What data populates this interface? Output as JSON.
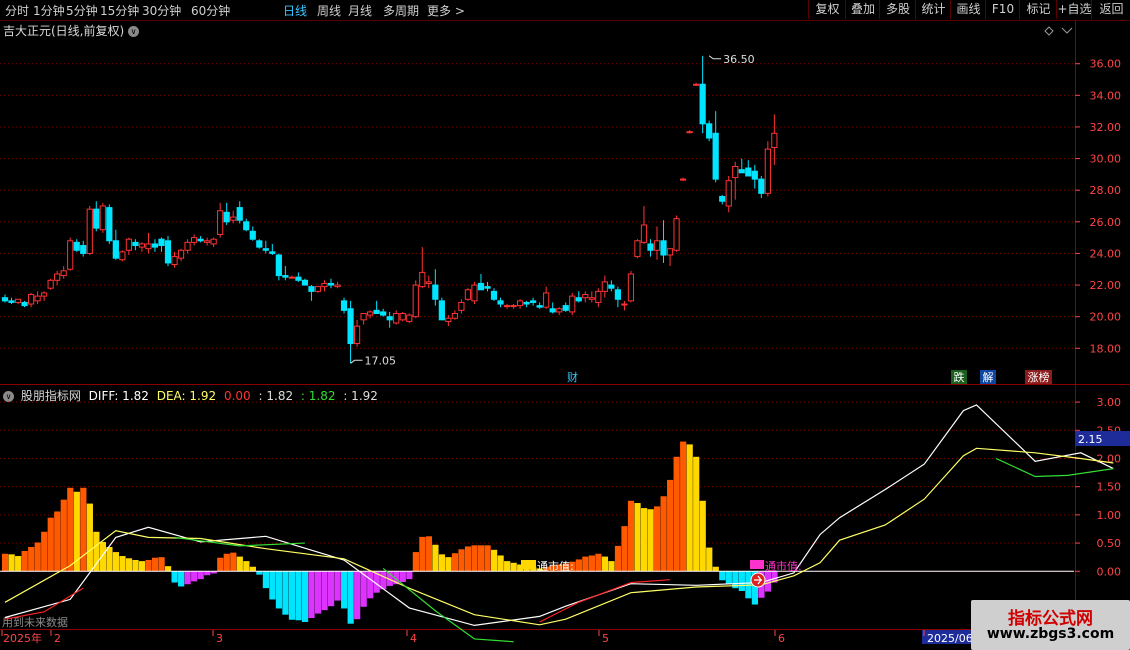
{
  "toolbar": {
    "periods": [
      "分时",
      "1分钟",
      "5分钟",
      "15分钟",
      "30分钟",
      "60分钟",
      "日线",
      "周线",
      "月线",
      "多周期",
      "更多 >"
    ],
    "active_period": "日线",
    "right_buttons": [
      "复权",
      "叠加",
      "多股",
      "统计",
      "画线",
      "F10",
      "标记",
      "+自选",
      "返回"
    ]
  },
  "stock": {
    "title": "吉大正元(日线,前复权)",
    "high_label": "36.50",
    "low_label": "17.05",
    "badges": {
      "cai": "财",
      "die": "跌",
      "jie": "解",
      "zhang": "涨榜"
    }
  },
  "price_axis": {
    "ticks": [
      "36.00",
      "34.00",
      "32.00",
      "30.00",
      "28.00",
      "26.00",
      "24.00",
      "22.00",
      "20.00",
      "18.00"
    ]
  },
  "indicator": {
    "name": "股朋指标网",
    "diff_label": "DIFF: 1.82",
    "dea_label": "DEA: 1.92",
    "v1": "0.00",
    "v2": ": 1.82",
    "v3": ": 1.82",
    "v4": ": 1.92",
    "ticks": [
      "3.00",
      "2.50",
      "2.00",
      "1.50",
      "1.00",
      "0.50",
      "0.00"
    ],
    "current_value": "2.15",
    "label_a": "通市值:",
    "label_b": "通市值:",
    "future_note": "用到未来数据"
  },
  "date_axis": {
    "labels": [
      "2025年",
      "2",
      "3",
      "4",
      "5",
      "6",
      "2025/06"
    ]
  },
  "watermark": {
    "title": "指标公式网",
    "url": "www.zbgs3.com"
  },
  "colors": {
    "up": "#ff3333",
    "down": "#00e5ff",
    "bar_orange": "#ff5a00",
    "bar_yellow": "#ffd800",
    "bar_cyan": "#00e5ff",
    "bar_magenta": "#dd33ff",
    "diff": "#ffffff",
    "dea": "#ffff66",
    "grid": "#7a0000",
    "axis_text": "#ff4444"
  },
  "chart_data": [
    {
      "type": "candlestick",
      "ylim": [
        16.5,
        37.5
      ],
      "candles": [
        [
          21.2,
          21.4,
          20.9,
          21.0
        ],
        [
          21.0,
          21.2,
          20.8,
          20.9
        ],
        [
          20.9,
          21.1,
          20.8,
          21.1
        ],
        [
          20.9,
          21.0,
          20.6,
          20.7
        ],
        [
          20.8,
          21.5,
          20.6,
          21.4
        ],
        [
          21.0,
          21.6,
          20.8,
          21.3
        ],
        [
          21.3,
          21.6,
          21.0,
          21.5
        ],
        [
          21.8,
          22.4,
          21.7,
          22.3
        ],
        [
          22.3,
          22.9,
          22.0,
          22.7
        ],
        [
          22.6,
          23.2,
          22.4,
          22.9
        ],
        [
          23.0,
          25.0,
          22.9,
          24.8
        ],
        [
          24.7,
          24.9,
          24.1,
          24.2
        ],
        [
          24.5,
          24.8,
          23.8,
          24.0
        ],
        [
          24.0,
          27.0,
          23.9,
          26.8
        ],
        [
          26.8,
          27.3,
          25.4,
          25.6
        ],
        [
          25.5,
          27.2,
          25.3,
          27.0
        ],
        [
          26.9,
          27.1,
          24.6,
          24.8
        ],
        [
          24.8,
          25.5,
          23.6,
          23.7
        ],
        [
          23.6,
          24.2,
          23.5,
          24.1
        ],
        [
          24.2,
          25.0,
          23.9,
          24.9
        ],
        [
          24.7,
          24.9,
          24.2,
          24.5
        ],
        [
          24.4,
          24.7,
          24.1,
          24.6
        ],
        [
          24.3,
          25.3,
          24.0,
          24.6
        ],
        [
          24.6,
          24.9,
          24.1,
          24.4
        ],
        [
          24.9,
          25.0,
          24.1,
          24.5
        ],
        [
          24.8,
          25.1,
          23.2,
          23.4
        ],
        [
          23.3,
          24.1,
          23.1,
          23.8
        ],
        [
          23.7,
          24.3,
          23.5,
          24.2
        ],
        [
          24.2,
          24.9,
          24.0,
          24.7
        ],
        [
          24.7,
          25.2,
          24.5,
          25.0
        ],
        [
          24.9,
          25.1,
          24.7,
          24.8
        ],
        [
          24.7,
          25.0,
          24.5,
          24.8
        ],
        [
          24.6,
          25.0,
          24.4,
          24.9
        ],
        [
          25.2,
          27.2,
          25.0,
          26.7
        ],
        [
          26.6,
          27.2,
          25.8,
          26.0
        ],
        [
          26.1,
          26.7,
          25.9,
          26.3
        ],
        [
          26.9,
          27.3,
          25.9,
          26.1
        ],
        [
          26.0,
          26.2,
          25.4,
          25.5
        ],
        [
          25.4,
          25.7,
          24.8,
          24.9
        ],
        [
          24.8,
          24.9,
          24.3,
          24.4
        ],
        [
          24.3,
          24.8,
          24.0,
          24.2
        ],
        [
          24.1,
          24.6,
          23.9,
          24.0
        ],
        [
          23.9,
          24.0,
          22.3,
          22.6
        ],
        [
          22.6,
          23.2,
          22.3,
          22.5
        ],
        [
          22.5,
          22.6,
          22.4,
          22.5
        ],
        [
          22.5,
          22.8,
          22.2,
          22.3
        ],
        [
          22.3,
          22.4,
          22.0,
          22.0
        ],
        [
          21.9,
          22.0,
          21.0,
          21.6
        ],
        [
          21.6,
          21.9,
          21.5,
          21.9
        ],
        [
          21.9,
          22.3,
          21.6,
          22.1
        ],
        [
          22.1,
          22.4,
          21.8,
          22.0
        ],
        [
          21.9,
          22.2,
          21.8,
          22.0
        ],
        [
          21.0,
          21.2,
          20.2,
          20.4
        ],
        [
          20.5,
          21.0,
          17.05,
          18.3
        ],
        [
          18.3,
          19.8,
          18.1,
          19.4
        ],
        [
          19.8,
          20.2,
          19.5,
          20.2
        ],
        [
          20.1,
          20.4,
          19.9,
          20.3
        ],
        [
          20.4,
          21.0,
          20.2,
          20.2
        ],
        [
          20.3,
          20.5,
          20.0,
          20.1
        ],
        [
          20.0,
          20.3,
          19.3,
          19.8
        ],
        [
          19.6,
          20.4,
          19.5,
          20.2
        ],
        [
          19.8,
          20.3,
          19.7,
          20.2
        ],
        [
          19.7,
          20.2,
          19.6,
          20.1
        ],
        [
          20.0,
          22.3,
          19.9,
          22.0
        ],
        [
          21.9,
          24.4,
          21.8,
          22.8
        ],
        [
          22.1,
          22.6,
          21.8,
          22.2
        ],
        [
          22.0,
          23.0,
          20.7,
          21.1
        ],
        [
          21.0,
          21.2,
          19.8,
          19.8
        ],
        [
          19.7,
          20.1,
          19.4,
          19.9
        ],
        [
          19.9,
          20.4,
          19.8,
          20.2
        ],
        [
          20.4,
          21.1,
          20.2,
          20.9
        ],
        [
          21.1,
          21.8,
          21.0,
          21.7
        ],
        [
          21.0,
          22.2,
          20.8,
          22.0
        ],
        [
          22.1,
          22.7,
          21.8,
          21.7
        ],
        [
          21.9,
          22.2,
          21.6,
          21.8
        ],
        [
          21.6,
          21.8,
          21.0,
          21.1
        ],
        [
          21.0,
          21.2,
          20.6,
          20.8
        ],
        [
          20.7,
          20.8,
          20.5,
          20.7
        ],
        [
          20.7,
          20.8,
          20.5,
          20.7
        ],
        [
          20.7,
          21.1,
          20.5,
          21.0
        ],
        [
          20.9,
          21.0,
          20.6,
          20.8
        ],
        [
          21.0,
          21.2,
          20.7,
          20.9
        ],
        [
          20.7,
          20.9,
          20.5,
          20.6
        ],
        [
          20.6,
          21.9,
          20.5,
          21.5
        ],
        [
          20.5,
          20.9,
          20.2,
          20.3
        ],
        [
          20.3,
          20.6,
          20.1,
          20.5
        ],
        [
          20.7,
          20.9,
          20.3,
          20.4
        ],
        [
          20.3,
          21.5,
          20.1,
          21.3
        ],
        [
          21.2,
          21.6,
          20.9,
          21.0
        ],
        [
          21.2,
          21.6,
          20.9,
          21.4
        ],
        [
          21.1,
          21.6,
          20.9,
          21.2
        ],
        [
          20.9,
          21.8,
          20.6,
          21.6
        ],
        [
          21.6,
          22.6,
          21.2,
          22.2
        ],
        [
          22.0,
          22.3,
          21.6,
          21.8
        ],
        [
          21.7,
          21.9,
          20.6,
          21.1
        ],
        [
          20.8,
          21.0,
          20.4,
          20.8
        ],
        [
          21.0,
          22.9,
          20.9,
          22.7
        ],
        [
          23.8,
          24.9,
          23.7,
          24.8
        ],
        [
          24.7,
          27.0,
          24.6,
          25.8
        ],
        [
          24.6,
          24.9,
          23.8,
          24.2
        ],
        [
          24.2,
          25.7,
          23.6,
          24.8
        ],
        [
          24.8,
          26.1,
          23.4,
          23.9
        ],
        [
          23.9,
          24.2,
          23.2,
          24.3
        ],
        [
          24.2,
          26.4,
          24.1,
          26.2
        ],
        [
          28.7,
          28.8,
          28.6,
          28.7
        ],
        [
          31.7,
          31.8,
          31.6,
          31.7
        ],
        [
          34.7,
          34.8,
          34.6,
          34.7
        ],
        [
          34.7,
          36.5,
          31.6,
          32.2
        ],
        [
          32.2,
          32.4,
          31.1,
          31.3
        ],
        [
          31.6,
          33.0,
          28.5,
          28.7
        ],
        [
          27.6,
          27.7,
          27.1,
          27.3
        ],
        [
          27.0,
          28.9,
          26.6,
          28.6
        ],
        [
          28.8,
          29.8,
          27.4,
          29.5
        ],
        [
          29.3,
          30.0,
          29.1,
          29.1
        ],
        [
          29.4,
          29.9,
          28.9,
          28.9
        ],
        [
          29.2,
          29.6,
          28.1,
          28.7
        ],
        [
          28.7,
          28.9,
          27.5,
          27.8
        ],
        [
          27.8,
          31.1,
          27.6,
          30.6
        ],
        [
          30.7,
          32.8,
          29.6,
          31.6
        ]
      ]
    },
    {
      "type": "bar",
      "name": "MACD histogram",
      "ylim": [
        -0.9,
        3.25
      ],
      "values": [
        0.31,
        0.3,
        0.27,
        0.36,
        0.43,
        0.51,
        0.7,
        0.95,
        1.06,
        1.27,
        1.48,
        1.41,
        1.48,
        1.2,
        0.7,
        0.52,
        0.43,
        0.34,
        0.27,
        0.23,
        0.2,
        0.18,
        0.2,
        0.24,
        0.25,
        0.09,
        -0.2,
        -0.27,
        -0.23,
        -0.18,
        -0.14,
        -0.07,
        -0.04,
        0.24,
        0.31,
        0.33,
        0.26,
        0.18,
        0.08,
        -0.06,
        -0.3,
        -0.5,
        -0.66,
        -0.77,
        -0.86,
        -0.87,
        -0.9,
        -0.83,
        -0.75,
        -0.69,
        -0.62,
        -0.52,
        -0.66,
        -0.93,
        -0.85,
        -0.63,
        -0.48,
        -0.38,
        -0.32,
        -0.26,
        -0.23,
        -0.19,
        -0.14,
        0.34,
        0.61,
        0.62,
        0.47,
        0.3,
        0.25,
        0.32,
        0.39,
        0.44,
        0.46,
        0.46,
        0.46,
        0.38,
        0.28,
        0.18,
        0.15,
        0.12,
        0.11,
        0.08,
        0.05,
        0.08,
        0.1,
        0.12,
        0.14,
        0.17,
        0.21,
        0.26,
        0.28,
        0.31,
        0.26,
        0.18,
        0.45,
        0.8,
        1.25,
        1.21,
        1.12,
        1.1,
        1.15,
        1.33,
        1.62,
        2.03,
        2.3,
        2.25,
        2.03,
        1.25,
        0.42,
        0.08,
        -0.16,
        -0.23,
        -0.3,
        -0.35,
        -0.48,
        -0.59,
        -0.47,
        -0.36,
        -0.2
      ]
    },
    {
      "type": "line",
      "ylim": [
        -0.9,
        3.25
      ],
      "series": [
        {
          "name": "DIFF",
          "points": [
            [
              0,
              -0.82
            ],
            [
              10,
              -0.5
            ],
            [
              17,
              0.6
            ],
            [
              22,
              0.78
            ],
            [
              30,
              0.52
            ],
            [
              40,
              0.62
            ],
            [
              52,
              0.2
            ],
            [
              62,
              -0.65
            ],
            [
              72,
              -0.96
            ],
            [
              82,
              -0.8
            ],
            [
              86,
              -0.62
            ],
            [
              96,
              -0.22
            ],
            [
              106,
              -0.25
            ],
            [
              116,
              -0.2
            ],
            [
              121,
              -0.03
            ],
            [
              125,
              0.65
            ],
            [
              128,
              0.95
            ],
            [
              135,
              1.45
            ],
            [
              141,
              1.9
            ],
            [
              147,
              2.85
            ],
            [
              149,
              2.95
            ],
            [
              158,
              1.95
            ],
            [
              165,
              2.1
            ],
            [
              170,
              1.82
            ]
          ]
        },
        {
          "name": "DEA",
          "points": [
            [
              0,
              -0.55
            ],
            [
              10,
              0.1
            ],
            [
              17,
              0.72
            ],
            [
              22,
              0.6
            ],
            [
              30,
              0.58
            ],
            [
              40,
              0.4
            ],
            [
              52,
              0.22
            ],
            [
              62,
              -0.3
            ],
            [
              72,
              -0.77
            ],
            [
              82,
              -0.95
            ],
            [
              86,
              -0.85
            ],
            [
              96,
              -0.38
            ],
            [
              106,
              -0.28
            ],
            [
              116,
              -0.24
            ],
            [
              121,
              -0.08
            ],
            [
              125,
              0.15
            ],
            [
              128,
              0.55
            ],
            [
              135,
              0.82
            ],
            [
              141,
              1.28
            ],
            [
              147,
              2.05
            ],
            [
              149,
              2.18
            ],
            [
              158,
              2.1
            ],
            [
              165,
              2.0
            ],
            [
              170,
              1.92
            ]
          ]
        }
      ]
    }
  ]
}
